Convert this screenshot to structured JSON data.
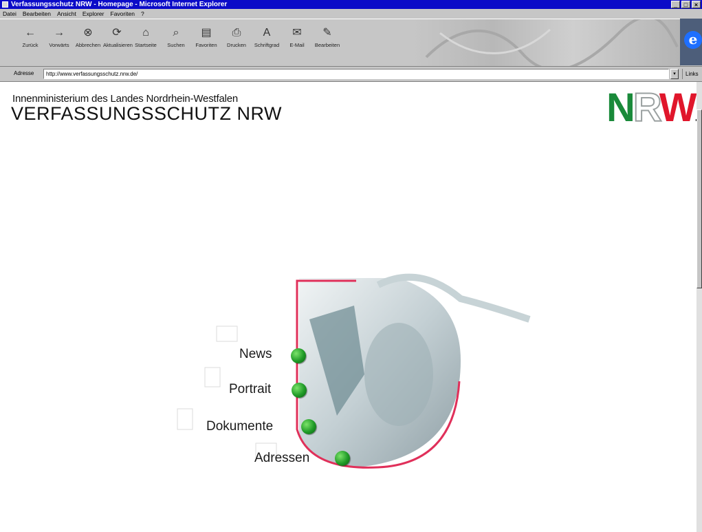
{
  "window": {
    "title": "Verfassungsschutz NRW - Homepage - Microsoft Internet Explorer",
    "buttons": [
      "_",
      "□",
      "×"
    ]
  },
  "menu": [
    "Datei",
    "Bearbeiten",
    "Ansicht",
    "Explorer",
    "Favoriten",
    "?"
  ],
  "toolbar": [
    {
      "label": "Zurück",
      "icon": "back-arrow-icon",
      "glyph": "←"
    },
    {
      "label": "Vorwärts",
      "icon": "forward-arrow-icon",
      "glyph": "→"
    },
    {
      "label": "Abbrechen",
      "icon": "stop-icon",
      "glyph": "⊗"
    },
    {
      "label": "Aktualisieren",
      "icon": "refresh-icon",
      "glyph": "⟳"
    },
    {
      "label": "Startseite",
      "icon": "home-icon",
      "glyph": "⌂"
    },
    {
      "label": "Suchen",
      "icon": "search-icon",
      "glyph": "⌕"
    },
    {
      "label": "Favoriten",
      "icon": "favorites-icon",
      "glyph": "▤"
    },
    {
      "label": "Drucken",
      "icon": "print-icon",
      "glyph": "⎙"
    },
    {
      "label": "Schriftgrad",
      "icon": "font-icon",
      "glyph": "A"
    },
    {
      "label": "E-Mail",
      "icon": "mail-icon",
      "glyph": "✉"
    },
    {
      "label": "Bearbeiten",
      "icon": "edit-icon",
      "glyph": "✎"
    }
  ],
  "address": {
    "label": "Adresse",
    "url": "http://www.verfassungsschutz.nrw.de/",
    "go_label": "Links"
  },
  "page": {
    "supertitle": "Innenministerium des Landes Nordrhein-Westfalen",
    "title": "VERFASSUNGSSCHUTZ NRW",
    "logo": {
      "n": "N",
      "r": "R",
      "w": "W"
    },
    "nav": [
      {
        "label": "News",
        "icon": "newspaper-icon"
      },
      {
        "label": "Portrait",
        "icon": "portrait-icon"
      },
      {
        "label": "Dokumente",
        "icon": "document-icon"
      },
      {
        "label": "Adressen",
        "icon": "envelope-icon"
      }
    ]
  },
  "colors": {
    "titlebar": "#0b0bc8",
    "chrome": "#c6c6c6",
    "arc": "#e0305a",
    "nav_dot": "#1f9a27",
    "logo_green": "#1a8a3a",
    "logo_red": "#e0162b"
  }
}
